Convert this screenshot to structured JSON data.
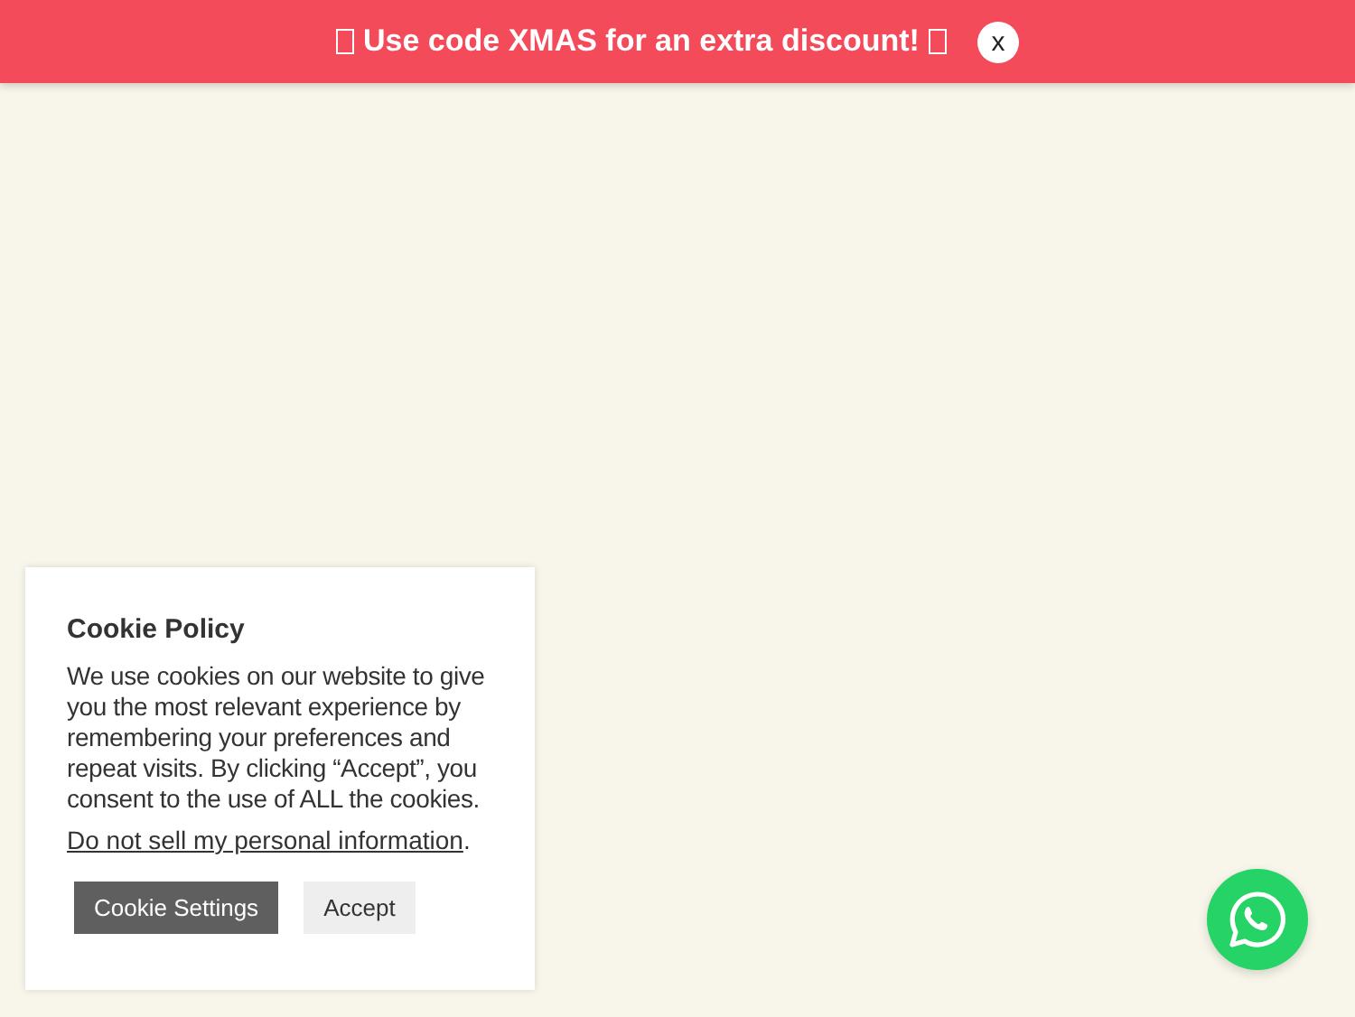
{
  "banner": {
    "text": "Use code XMAS for an extra discount!",
    "close": "x"
  },
  "cookie_notice": {
    "title": "Cookie Policy",
    "body": "We use cookies on our website to give you the most relevant experience by remembering your preferences and repeat visits. By clicking “Accept”, you consent to the use of ALL the cookies.",
    "link": "Do not sell my personal information",
    "link_suffix": ".",
    "buttons": [
      {
        "label": "Cookie Settings",
        "kind": "secondary"
      },
      {
        "label": "Accept",
        "kind": "primary"
      }
    ]
  }
}
